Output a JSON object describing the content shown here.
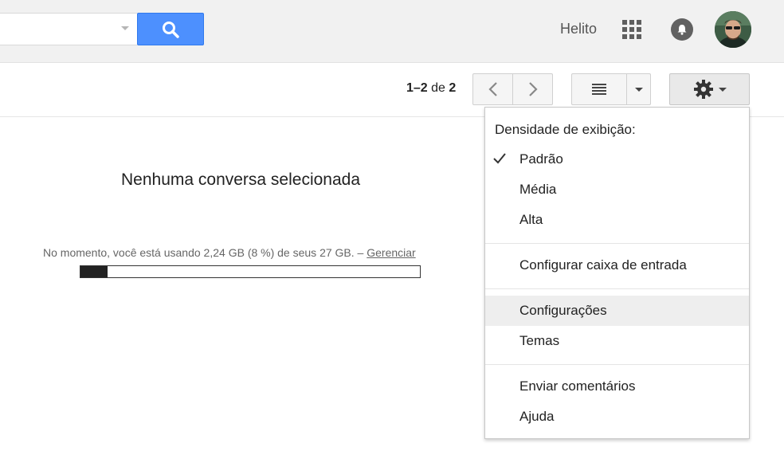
{
  "header": {
    "user_name": "Helito",
    "icons": {
      "search": "search-icon",
      "apps": "apps-grid-icon",
      "notifications": "bell-icon",
      "account": "avatar"
    },
    "colors": {
      "search_button": "#4d90fe",
      "header_bg": "#f1f1f1"
    }
  },
  "toolbar": {
    "pager_range": "1–2",
    "pager_of": "de",
    "pager_total": "2"
  },
  "main": {
    "empty_message": "Nenhuma conversa selecionada",
    "storage_text": "No momento, você está usando 2,24 GB (8 %) de seus 27 GB. –",
    "storage_link": "Gerenciar",
    "storage_used_fraction": 0.08
  },
  "menu": {
    "header": "Densidade de exibição:",
    "items": [
      {
        "label": "Padrão",
        "checked": true
      },
      {
        "label": "Média"
      },
      {
        "label": "Alta"
      },
      {
        "label": "Configurar caixa de entrada"
      },
      {
        "label": "Configurações",
        "highlighted": true
      },
      {
        "label": "Temas"
      },
      {
        "label": "Enviar comentários"
      },
      {
        "label": "Ajuda"
      }
    ]
  }
}
